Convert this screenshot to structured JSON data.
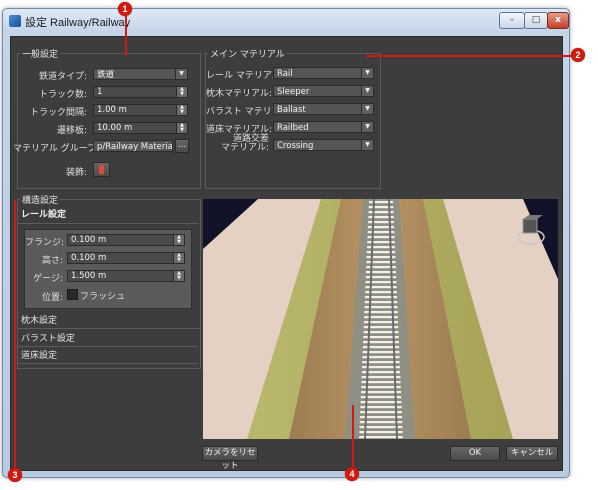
{
  "window": {
    "title": "設定 Railway/Railway",
    "minimize": "–",
    "maximize": "□",
    "close": "x"
  },
  "general": {
    "group_title": "一般設定",
    "rail_type_label": "鉄道タイプ:",
    "rail_type_value": "鉄道",
    "track_count_label": "トラック数:",
    "track_count_value": "1",
    "track_spacing_label": "トラック間隔:",
    "track_spacing_value": "1.00 m",
    "transition_label": "遷移板:",
    "transition_value": "10.00 m",
    "material_group_label": "マテリアル グループ:",
    "material_group_value": "p/Railway Materials",
    "browse_label": "...",
    "decoration_label": "装飾:"
  },
  "materials": {
    "group_title": "メイン マテリアル",
    "rail_label": "レール マテリアル:",
    "rail_value": "Rail",
    "sleeper_label": "枕木マテリアル:",
    "sleeper_value": "Sleeper",
    "ballast_label": "バラスト マテリアル:",
    "ballast_value": "Ballast",
    "bed_label": "道床マテリアル:",
    "bed_value": "Railbed",
    "crossing_label": "道路交差\nマテリアル:",
    "crossing_value": "Crossing"
  },
  "structure": {
    "group_title": "構造設定",
    "rail_settings_title": "レール設定",
    "flange_label": "フランジ:",
    "flange_value": "0.100 m",
    "height_label": "高さ:",
    "height_value": "0.100 m",
    "gauge_label": "ゲージ:",
    "gauge_value": "1.500 m",
    "position_label": "位置:",
    "flush_label": "フラッシュ",
    "sleeper_settings": "枕木設定",
    "ballast_settings": "バラスト設定",
    "bed_settings": "道床設定"
  },
  "footer": {
    "reset_camera": "カメラをリセット",
    "ok": "OK",
    "cancel": "キャンセル"
  },
  "callouts": [
    "1",
    "2",
    "3",
    "4"
  ],
  "colors": {
    "callout": "#d01a10",
    "panel": "#3d3d3d",
    "preview_bg": "#111228"
  }
}
